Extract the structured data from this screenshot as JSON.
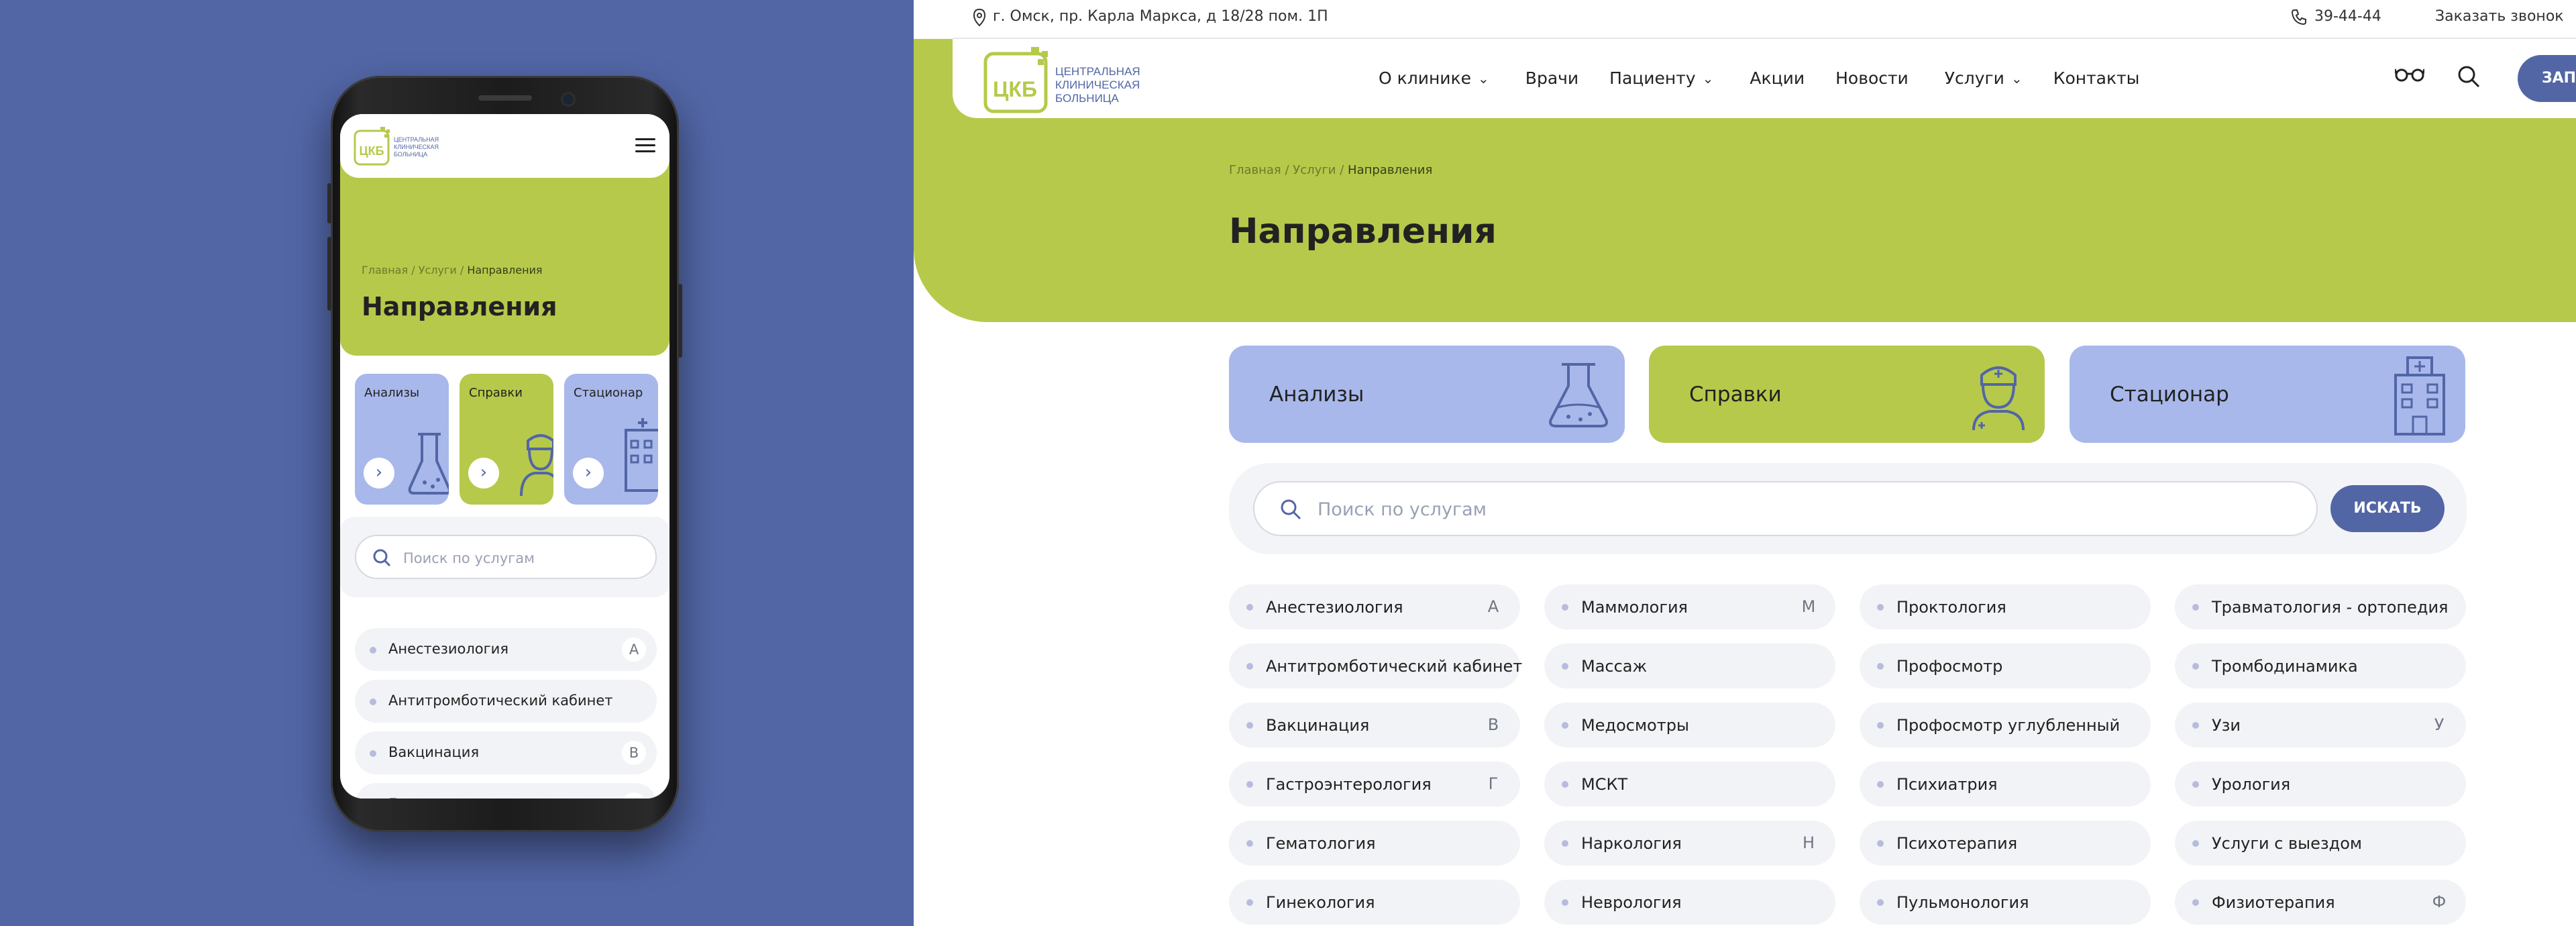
{
  "brand": {
    "logo_abbr": "ЦКБ",
    "logo_lines": [
      "ЦЕНТРАЛЬНАЯ",
      "КЛИНИЧЕСКАЯ",
      "БОЛЬНИЦА"
    ]
  },
  "colors": {
    "accent_green": "#b7c94a",
    "accent_blue": "#5266a6",
    "card_blue": "#a8b8eb",
    "chip_bg": "#f2f3f6",
    "dot": "#b7bcde"
  },
  "topbar": {
    "address": "г. Омск, пр. Карла Маркса, д 18/28 пом. 1П",
    "phone": "39-44-44",
    "callback": "Заказать звонок"
  },
  "nav": {
    "items": [
      {
        "label": "О клинике",
        "dropdown": true
      },
      {
        "label": "Врачи",
        "dropdown": false
      },
      {
        "label": "Пациенту",
        "dropdown": true
      },
      {
        "label": "Акции",
        "dropdown": false
      },
      {
        "label": "Новости",
        "dropdown": false
      },
      {
        "label": "Услуги",
        "dropdown": true
      },
      {
        "label": "Контакты",
        "dropdown": false
      }
    ],
    "cta_label": "ЗАП",
    "icons": [
      "glasses-icon",
      "search-icon"
    ]
  },
  "breadcrumbs": [
    "Главная",
    "Услуги",
    "Направления"
  ],
  "breadcrumb_sep": "/",
  "page_title": "Направления",
  "categories": [
    {
      "label": "Анализы",
      "icon": "flask-icon"
    },
    {
      "label": "Справки",
      "icon": "doctor-icon"
    },
    {
      "label": "Стационар",
      "icon": "hospital-icon"
    }
  ],
  "search": {
    "placeholder": "Поиск по услугам",
    "button_label": "ИСКАТЬ"
  },
  "services": [
    [
      {
        "name": "Анестезиология",
        "letter": "А"
      },
      {
        "name": "Антитромботический кабинет",
        "letter": ""
      },
      {
        "name": "Вакцинация",
        "letter": "В"
      },
      {
        "name": "Гастроэнтерология",
        "letter": "Г"
      },
      {
        "name": "Гематология",
        "letter": ""
      },
      {
        "name": "Гинекология",
        "letter": ""
      }
    ],
    [
      {
        "name": "Маммология",
        "letter": "М"
      },
      {
        "name": "Массаж",
        "letter": ""
      },
      {
        "name": "Медосмотры",
        "letter": ""
      },
      {
        "name": "МСКТ",
        "letter": ""
      },
      {
        "name": "Наркология",
        "letter": "Н"
      },
      {
        "name": "Неврология",
        "letter": ""
      }
    ],
    [
      {
        "name": "Проктология",
        "letter": ""
      },
      {
        "name": "Профосмотр",
        "letter": ""
      },
      {
        "name": "Профосмотр углубленный",
        "letter": ""
      },
      {
        "name": "Психиатрия",
        "letter": ""
      },
      {
        "name": "Психотерапия",
        "letter": ""
      },
      {
        "name": "Пульмонология",
        "letter": ""
      }
    ],
    [
      {
        "name": "Травматология - ортопедия",
        "letter": ""
      },
      {
        "name": "Тромбодинамика",
        "letter": ""
      },
      {
        "name": "Узи",
        "letter": "У"
      },
      {
        "name": "Урология",
        "letter": ""
      },
      {
        "name": "Услуги с выездом",
        "letter": ""
      },
      {
        "name": "Физиотерапия",
        "letter": "Ф"
      }
    ]
  ],
  "mobile": {
    "list": [
      {
        "name": "Анестезиология",
        "letter": "А"
      },
      {
        "name": "Антитромботический кабинет",
        "letter": ""
      },
      {
        "name": "Вакцинация",
        "letter": "В"
      },
      {
        "name": "Гастроэнтерология",
        "letter": "Г"
      },
      {
        "name": "Гематология",
        "letter": ""
      }
    ]
  }
}
